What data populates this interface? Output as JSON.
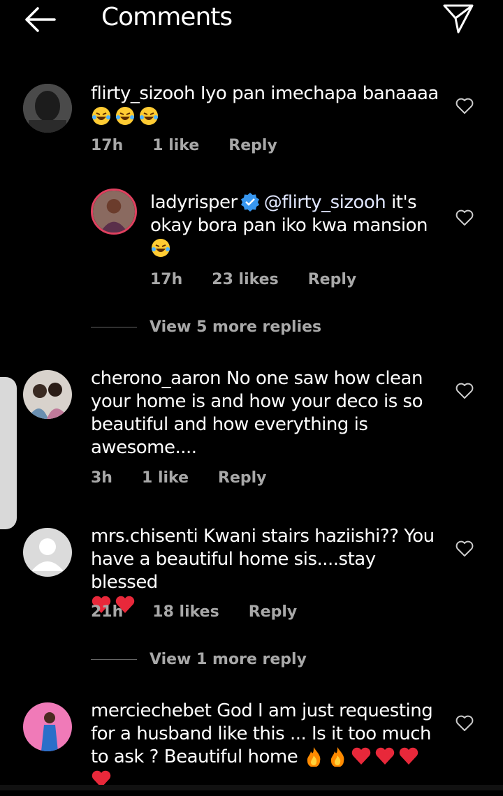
{
  "header": {
    "title": "Comments",
    "back_icon": "arrow-left-icon",
    "send_icon": "paper-plane-icon"
  },
  "comments": [
    {
      "username": "flirty_sizooh",
      "text": "Iyo pan imechapa banaaaa",
      "emojis": [
        "😂",
        "😂",
        "😂"
      ],
      "time": "17h",
      "likes": "1 like",
      "reply": "Reply"
    },
    {
      "username": "ladyrisper",
      "verified": true,
      "mention": "@flirty_sizooh",
      "text": "it's okay bora pan iko kwa mansion",
      "emojis": [
        "😂"
      ],
      "time": "17h",
      "likes": "23 likes",
      "reply": "Reply"
    },
    {
      "username": "cherono_aaron",
      "text": "No one  saw how  clean your  home is and how your deco is so beautiful and  how everything  is awesome....",
      "time": "3h",
      "likes": "1 like",
      "reply": "Reply"
    },
    {
      "username": "mrs.chisenti",
      "text": "Kwani stairs haziishi?? You have a beautiful home sis....stay blessed",
      "emojis": [
        "❤️",
        "❤️"
      ],
      "time": "21h",
      "likes": "18 likes",
      "reply": "Reply"
    },
    {
      "username": "merciechebet",
      "text": "God I am just requesting for a husband like this ... Is it too much to ask ? Beautiful home",
      "emojis": [
        "🔥",
        "🔥",
        "❤️",
        "❤️",
        "❤️",
        "❤️"
      ]
    }
  ],
  "view_more": [
    "View 5 more replies",
    "View 1 more reply"
  ],
  "colors": {
    "background": "#000000",
    "meta": "#a8a8a8",
    "verified": "#3897f0",
    "heart_red": "#e8283a",
    "fire": "#ff8a00"
  }
}
